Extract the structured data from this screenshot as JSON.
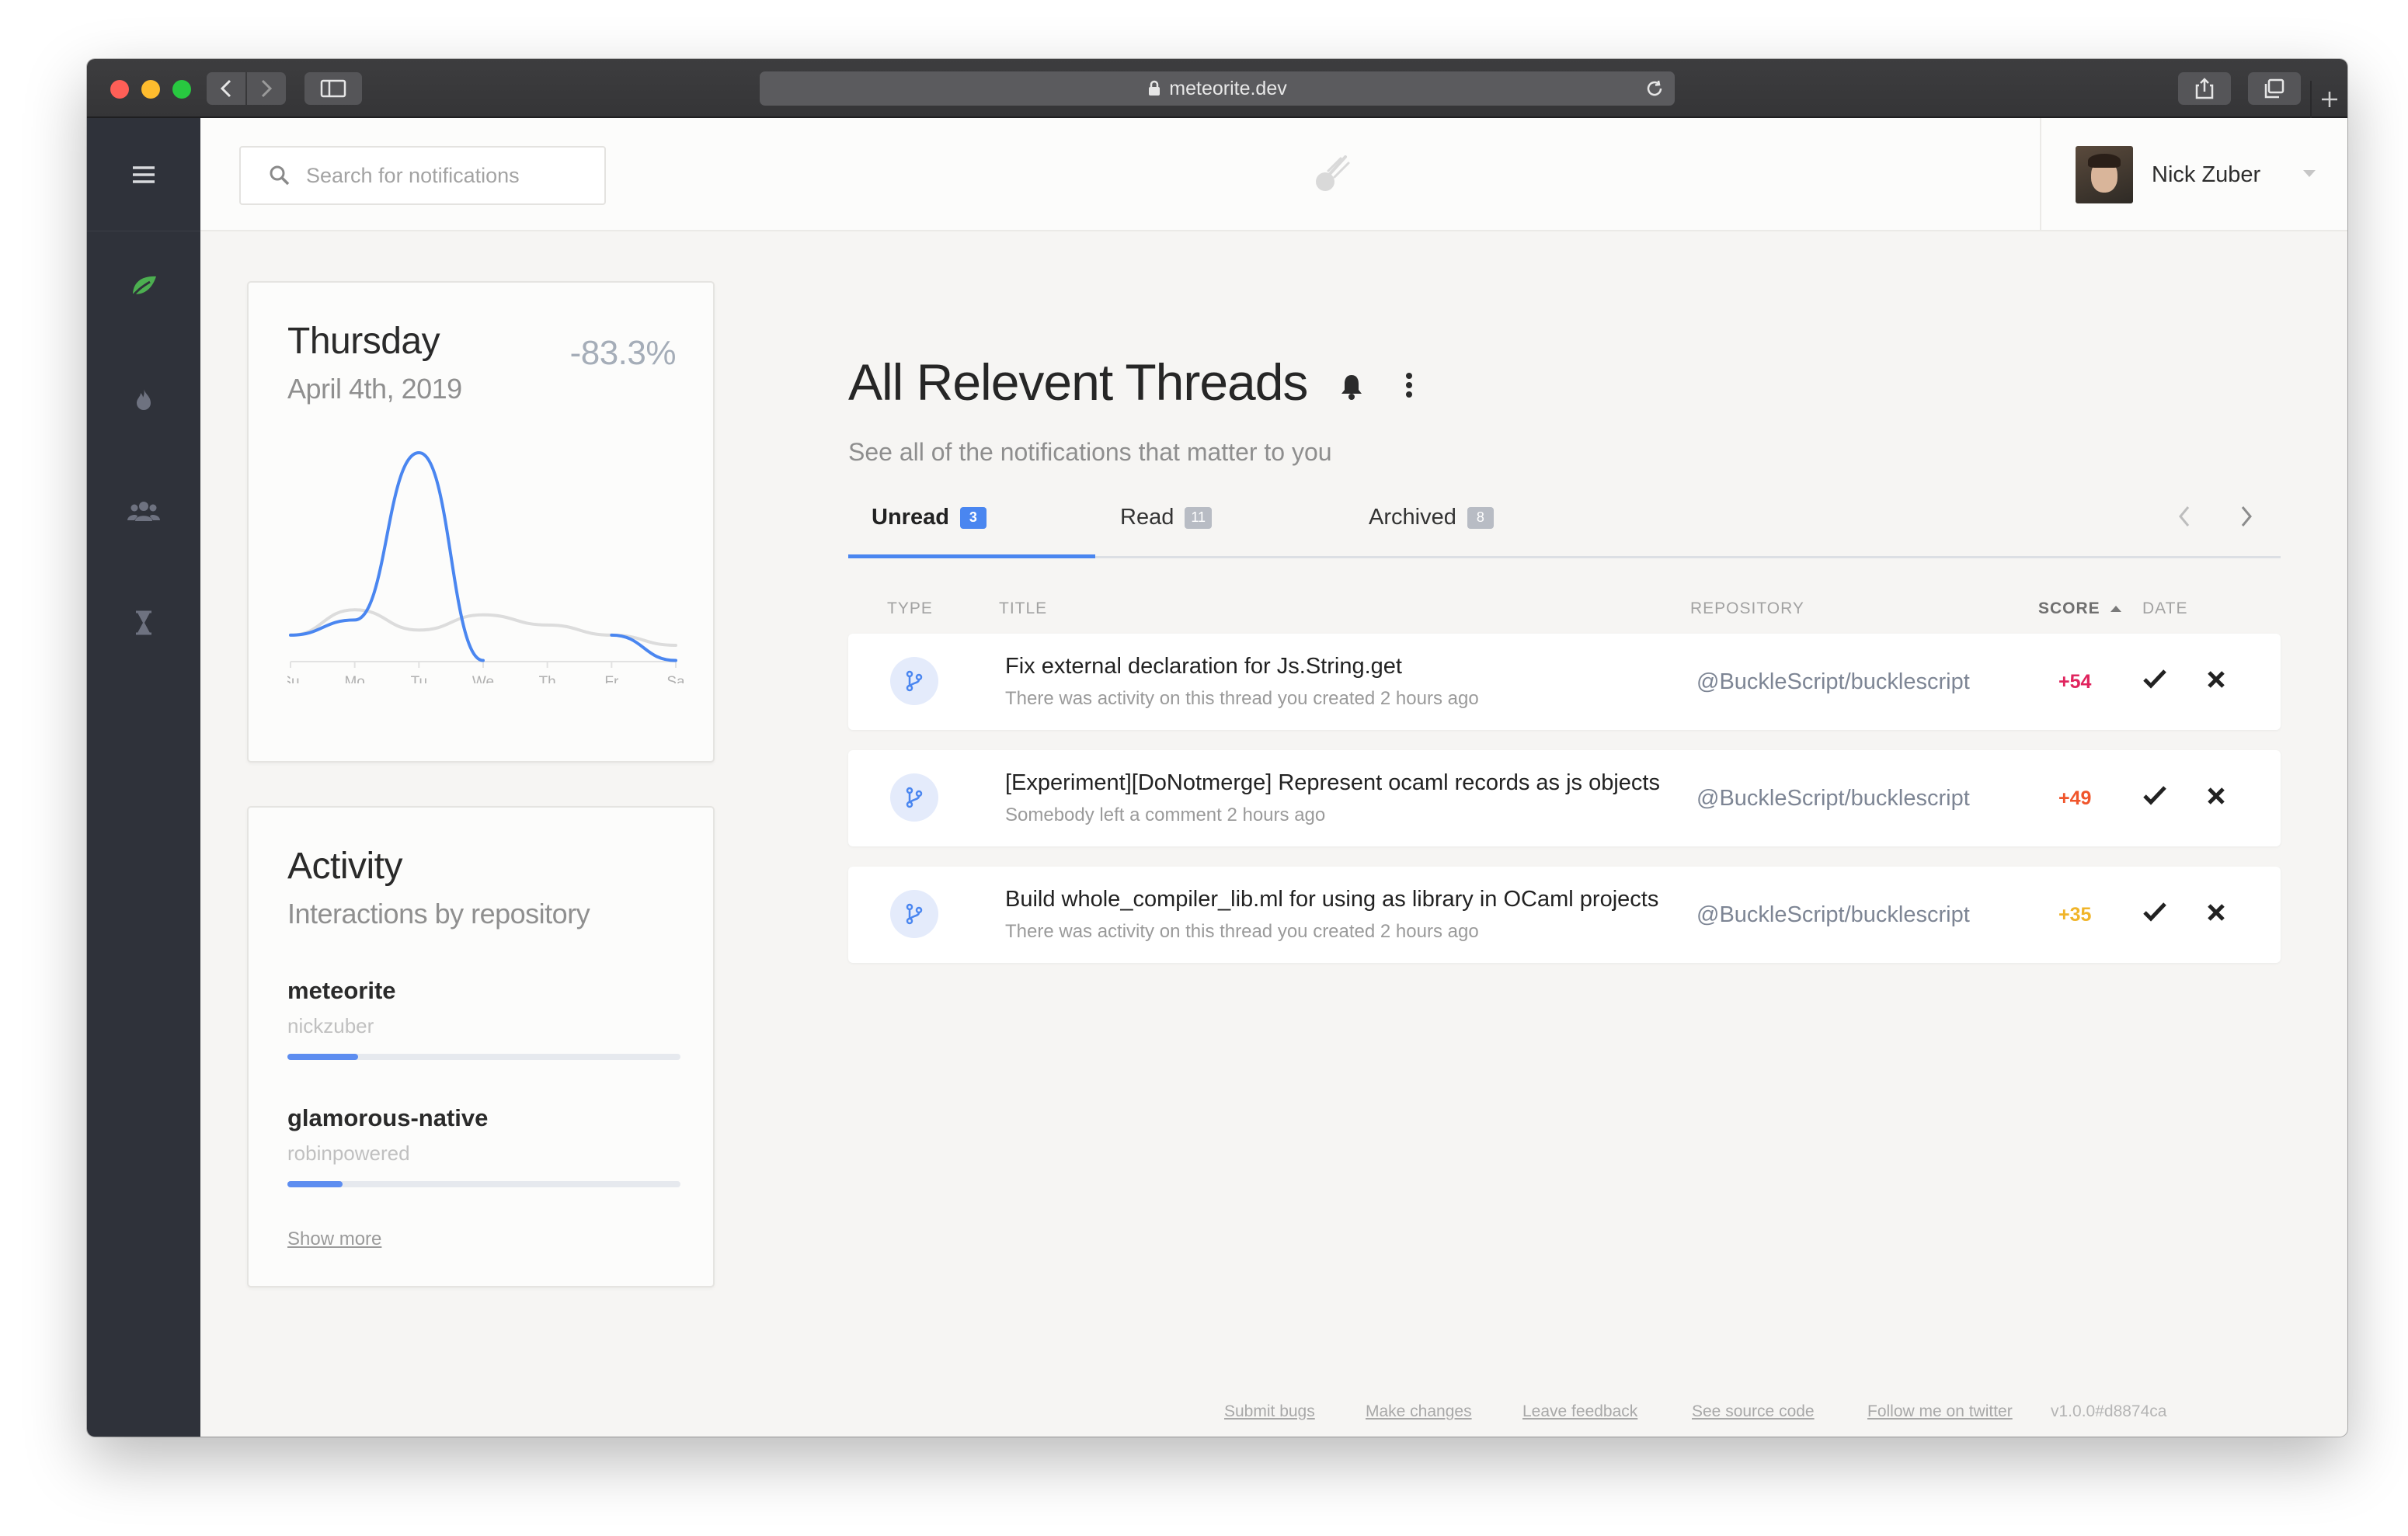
{
  "browser": {
    "url": "meteorite.dev",
    "colors": {
      "close": "#ff5f57",
      "minimize": "#febc2e",
      "maximize": "#28c840"
    }
  },
  "header": {
    "search_placeholder": "Search for notifications",
    "user_name": "Nick Zuber"
  },
  "sidebar": {
    "icons": [
      "menu-icon",
      "leaf-icon",
      "flame-icon",
      "users-icon",
      "hourglass-icon"
    ],
    "accent": "#4caf50"
  },
  "day_card": {
    "day": "Thursday",
    "date": "April 4th, 2019",
    "change": "-83.3%",
    "chart_data": {
      "type": "line",
      "categories": [
        "Su",
        "Mo",
        "Tu",
        "We",
        "Th",
        "Fr",
        "Sa"
      ],
      "series": [
        {
          "color": "#4a86f0",
          "values": [
            2,
            3.5,
            20,
            -0.5,
            null,
            2,
            -0.5
          ]
        },
        {
          "color": "#dcdcdc",
          "values": [
            2,
            4.5,
            2.5,
            4,
            3,
            2,
            1
          ]
        }
      ],
      "ylim": [
        0,
        21
      ],
      "grid": false
    }
  },
  "activity_card": {
    "title": "Activity",
    "subtitle": "Interactions by repository",
    "repos": [
      {
        "name": "meteorite",
        "owner": "nickzuber",
        "share": 0.18
      },
      {
        "name": "glamorous-native",
        "owner": "robinpowered",
        "share": 0.14
      }
    ],
    "show_more": "Show more"
  },
  "main": {
    "title": "All Relevent Threads",
    "subtitle": "See all of the notifications that matter to you",
    "tabs": [
      {
        "label": "Unread",
        "count": "3",
        "active": true,
        "badge_color": "#4a86f0"
      },
      {
        "label": "Read",
        "count": "11",
        "active": false,
        "badge_color": "#b8bcc4"
      },
      {
        "label": "Archived",
        "count": "8",
        "active": false,
        "badge_color": "#b8bcc4"
      }
    ],
    "columns": {
      "type": "TYPE",
      "title": "TITLE",
      "repository": "REPOSITORY",
      "score": "SCORE",
      "date": "DATE"
    },
    "rows": [
      {
        "title": "Fix external declaration for Js.String.get",
        "desc": "There was activity on this thread you created 2 hours ago",
        "repo": "@BuckleScript/bucklescript",
        "score": "+54",
        "score_color": "#e0245e"
      },
      {
        "title": "[Experiment][DoNotmerge] Represent ocaml records as js objects",
        "desc": "Somebody left a comment 2 hours ago",
        "repo": "@BuckleScript/bucklescript",
        "score": "+49",
        "score_color": "#f0552b"
      },
      {
        "title": "Build whole_compiler_lib.ml for using as library in OCaml projects",
        "desc": "There was activity on this thread you created 2 hours ago",
        "repo": "@BuckleScript/bucklescript",
        "score": "+35",
        "score_color": "#f0b429"
      }
    ]
  },
  "footer": {
    "links": [
      "Submit bugs",
      "Make changes",
      "Leave feedback",
      "See source code",
      "Follow me on twitter"
    ],
    "version": "v1.0.0#d8874ca"
  }
}
